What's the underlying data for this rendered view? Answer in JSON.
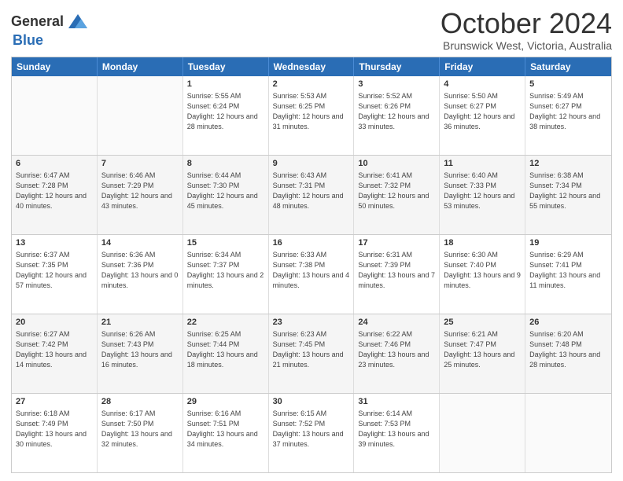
{
  "logo": {
    "general": "General",
    "blue": "Blue"
  },
  "title": "October 2024",
  "subtitle": "Brunswick West, Victoria, Australia",
  "days": [
    "Sunday",
    "Monday",
    "Tuesday",
    "Wednesday",
    "Thursday",
    "Friday",
    "Saturday"
  ],
  "rows": [
    [
      {
        "num": "",
        "info": ""
      },
      {
        "num": "",
        "info": ""
      },
      {
        "num": "1",
        "info": "Sunrise: 5:55 AM\nSunset: 6:24 PM\nDaylight: 12 hours and 28 minutes."
      },
      {
        "num": "2",
        "info": "Sunrise: 5:53 AM\nSunset: 6:25 PM\nDaylight: 12 hours and 31 minutes."
      },
      {
        "num": "3",
        "info": "Sunrise: 5:52 AM\nSunset: 6:26 PM\nDaylight: 12 hours and 33 minutes."
      },
      {
        "num": "4",
        "info": "Sunrise: 5:50 AM\nSunset: 6:27 PM\nDaylight: 12 hours and 36 minutes."
      },
      {
        "num": "5",
        "info": "Sunrise: 5:49 AM\nSunset: 6:27 PM\nDaylight: 12 hours and 38 minutes."
      }
    ],
    [
      {
        "num": "6",
        "info": "Sunrise: 6:47 AM\nSunset: 7:28 PM\nDaylight: 12 hours and 40 minutes."
      },
      {
        "num": "7",
        "info": "Sunrise: 6:46 AM\nSunset: 7:29 PM\nDaylight: 12 hours and 43 minutes."
      },
      {
        "num": "8",
        "info": "Sunrise: 6:44 AM\nSunset: 7:30 PM\nDaylight: 12 hours and 45 minutes."
      },
      {
        "num": "9",
        "info": "Sunrise: 6:43 AM\nSunset: 7:31 PM\nDaylight: 12 hours and 48 minutes."
      },
      {
        "num": "10",
        "info": "Sunrise: 6:41 AM\nSunset: 7:32 PM\nDaylight: 12 hours and 50 minutes."
      },
      {
        "num": "11",
        "info": "Sunrise: 6:40 AM\nSunset: 7:33 PM\nDaylight: 12 hours and 53 minutes."
      },
      {
        "num": "12",
        "info": "Sunrise: 6:38 AM\nSunset: 7:34 PM\nDaylight: 12 hours and 55 minutes."
      }
    ],
    [
      {
        "num": "13",
        "info": "Sunrise: 6:37 AM\nSunset: 7:35 PM\nDaylight: 12 hours and 57 minutes."
      },
      {
        "num": "14",
        "info": "Sunrise: 6:36 AM\nSunset: 7:36 PM\nDaylight: 13 hours and 0 minutes."
      },
      {
        "num": "15",
        "info": "Sunrise: 6:34 AM\nSunset: 7:37 PM\nDaylight: 13 hours and 2 minutes."
      },
      {
        "num": "16",
        "info": "Sunrise: 6:33 AM\nSunset: 7:38 PM\nDaylight: 13 hours and 4 minutes."
      },
      {
        "num": "17",
        "info": "Sunrise: 6:31 AM\nSunset: 7:39 PM\nDaylight: 13 hours and 7 minutes."
      },
      {
        "num": "18",
        "info": "Sunrise: 6:30 AM\nSunset: 7:40 PM\nDaylight: 13 hours and 9 minutes."
      },
      {
        "num": "19",
        "info": "Sunrise: 6:29 AM\nSunset: 7:41 PM\nDaylight: 13 hours and 11 minutes."
      }
    ],
    [
      {
        "num": "20",
        "info": "Sunrise: 6:27 AM\nSunset: 7:42 PM\nDaylight: 13 hours and 14 minutes."
      },
      {
        "num": "21",
        "info": "Sunrise: 6:26 AM\nSunset: 7:43 PM\nDaylight: 13 hours and 16 minutes."
      },
      {
        "num": "22",
        "info": "Sunrise: 6:25 AM\nSunset: 7:44 PM\nDaylight: 13 hours and 18 minutes."
      },
      {
        "num": "23",
        "info": "Sunrise: 6:23 AM\nSunset: 7:45 PM\nDaylight: 13 hours and 21 minutes."
      },
      {
        "num": "24",
        "info": "Sunrise: 6:22 AM\nSunset: 7:46 PM\nDaylight: 13 hours and 23 minutes."
      },
      {
        "num": "25",
        "info": "Sunrise: 6:21 AM\nSunset: 7:47 PM\nDaylight: 13 hours and 25 minutes."
      },
      {
        "num": "26",
        "info": "Sunrise: 6:20 AM\nSunset: 7:48 PM\nDaylight: 13 hours and 28 minutes."
      }
    ],
    [
      {
        "num": "27",
        "info": "Sunrise: 6:18 AM\nSunset: 7:49 PM\nDaylight: 13 hours and 30 minutes."
      },
      {
        "num": "28",
        "info": "Sunrise: 6:17 AM\nSunset: 7:50 PM\nDaylight: 13 hours and 32 minutes."
      },
      {
        "num": "29",
        "info": "Sunrise: 6:16 AM\nSunset: 7:51 PM\nDaylight: 13 hours and 34 minutes."
      },
      {
        "num": "30",
        "info": "Sunrise: 6:15 AM\nSunset: 7:52 PM\nDaylight: 13 hours and 37 minutes."
      },
      {
        "num": "31",
        "info": "Sunrise: 6:14 AM\nSunset: 7:53 PM\nDaylight: 13 hours and 39 minutes."
      },
      {
        "num": "",
        "info": ""
      },
      {
        "num": "",
        "info": ""
      }
    ]
  ]
}
